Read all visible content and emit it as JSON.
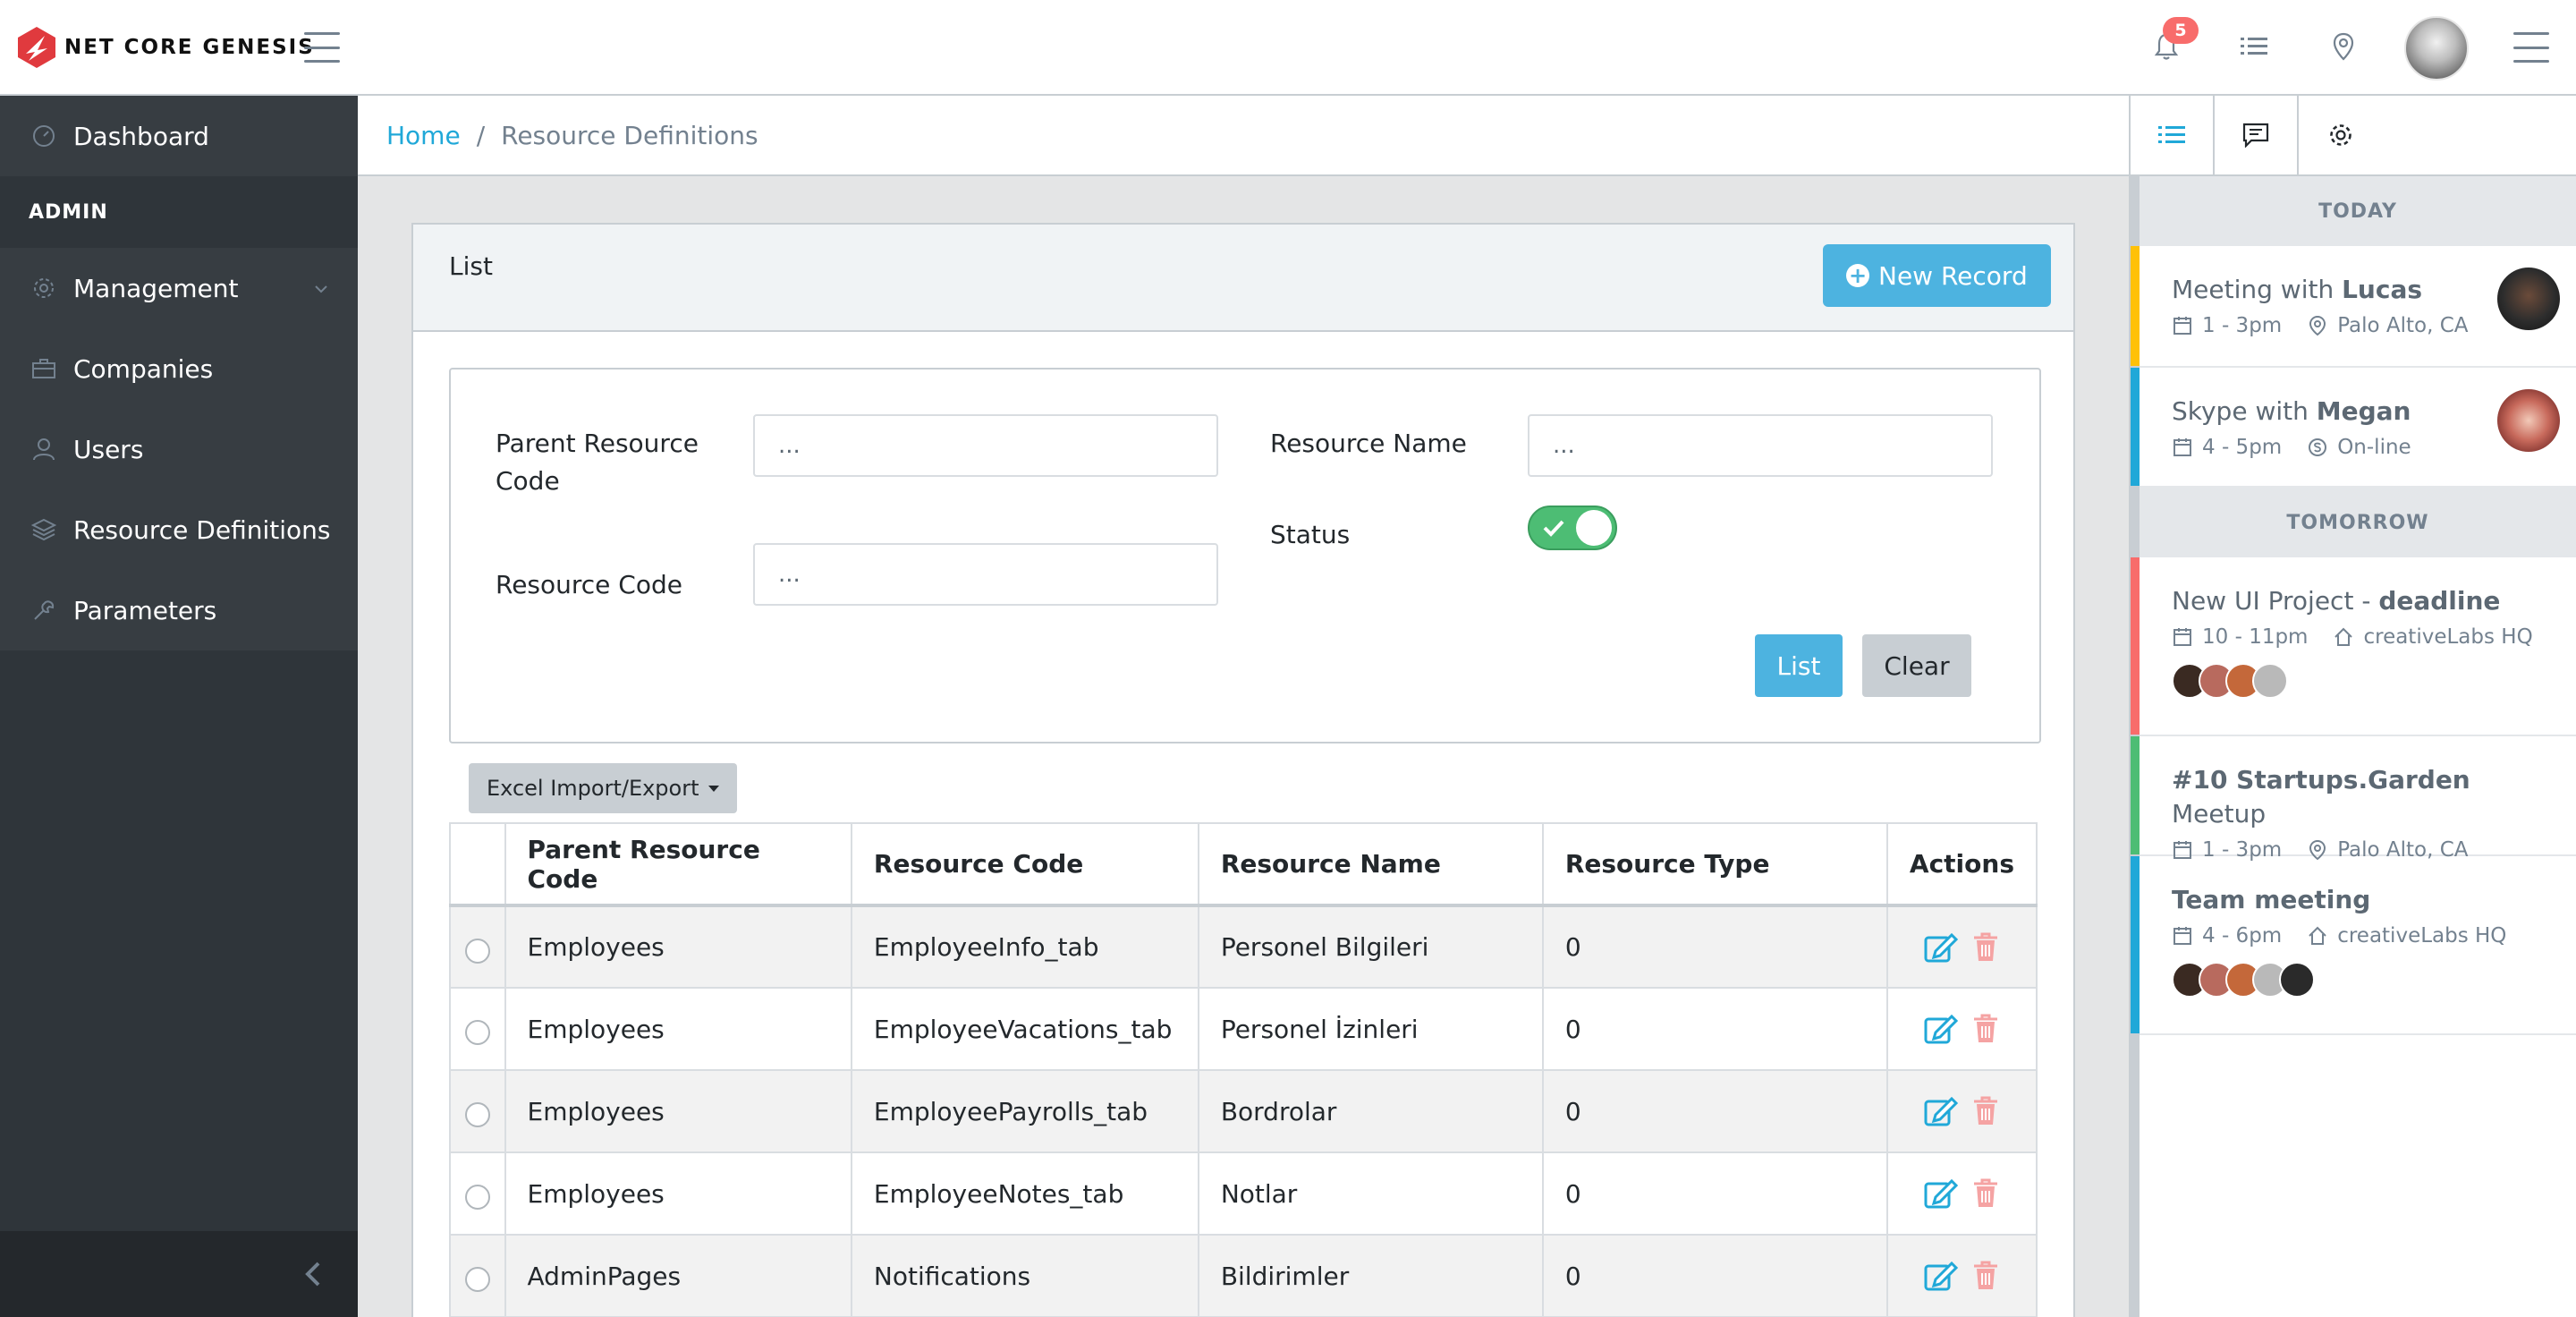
{
  "brand": {
    "name": "NET CORE GENESIS",
    "accent": "#e03a3e"
  },
  "header": {
    "notifications_count": "5"
  },
  "sidebar": {
    "items": [
      {
        "label": "Dashboard",
        "icon": "speedometer-icon"
      },
      {
        "label": "Management",
        "icon": "gear-icon",
        "has_submenu": true
      },
      {
        "label": "Companies",
        "icon": "briefcase-icon"
      },
      {
        "label": "Users",
        "icon": "user-icon"
      },
      {
        "label": "Resource Definitions",
        "icon": "layers-icon"
      },
      {
        "label": "Parameters",
        "icon": "wrench-icon"
      }
    ],
    "section_title": "ADMIN"
  },
  "breadcrumb": {
    "home": "Home",
    "current": "Resource Definitions"
  },
  "card": {
    "title": "List",
    "new_record": "New Record"
  },
  "filters": {
    "parent_resource_code_label_1": "Parent Resource",
    "parent_resource_code_label_2": "Code",
    "parent_resource_code_value": "...",
    "resource_code_label": "Resource Code",
    "resource_code_value": "...",
    "resource_name_label": "Resource Name",
    "resource_name_value": "...",
    "status_label": "Status",
    "status_on": true,
    "list_button": "List",
    "clear_button": "Clear"
  },
  "excel_button": "Excel Import/Export",
  "table": {
    "headers": [
      "Parent Resource Code",
      "Resource Code",
      "Resource Name",
      "Resource Type",
      "Actions"
    ],
    "rows": [
      [
        "Employees",
        "EmployeeInfo_tab",
        "Personel Bilgileri",
        "0"
      ],
      [
        "Employees",
        "EmployeeVacations_tab",
        "Personel İzinleri",
        "0"
      ],
      [
        "Employees",
        "EmployeePayrolls_tab",
        "Bordrolar",
        "0"
      ],
      [
        "Employees",
        "EmployeeNotes_tab",
        "Notlar",
        "0"
      ],
      [
        "AdminPages",
        "Notifications",
        "Bildirimler",
        "0"
      ]
    ]
  },
  "aside": {
    "today": "TODAY",
    "tomorrow": "TOMORROW",
    "events_today": [
      {
        "title_pre": "Meeting with ",
        "title_bold": "Lucas",
        "time": "1 - 3pm",
        "place": "Palo Alto, CA",
        "color": "#ffc107"
      },
      {
        "title_pre": "Skype with ",
        "title_bold": "Megan",
        "time": "4 - 5pm",
        "place": "On-line",
        "color": "#20a8d8"
      }
    ],
    "events_tomorrow": [
      {
        "title_pre": "New UI Project - ",
        "title_bold": "deadline",
        "time": "10 - 11pm",
        "place": "creativeLabs HQ",
        "color": "#f86c6b"
      },
      {
        "title_bold": "#10 Startups.Garden",
        "title_post": " Meetup",
        "time": "1 - 3pm",
        "place": "Palo Alto, CA",
        "color": "#4dbd74"
      },
      {
        "title_bold": "Team meeting",
        "time": "4 - 6pm",
        "place": "creativeLabs HQ",
        "color": "#20a8d8"
      }
    ]
  }
}
